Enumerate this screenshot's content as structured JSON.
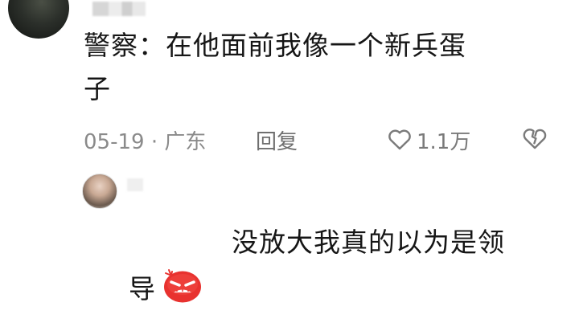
{
  "comments": [
    {
      "text_line1": "警察：在他面前我像一个新兵蛋",
      "text_line2": "子",
      "date_location": "05-19 · 广东",
      "reply_label": "回复",
      "like_count": "1.1万"
    },
    {
      "text_line1": "没放大我真的以为是领",
      "text_line2": "导"
    }
  ],
  "icons": {
    "like": "heart-outline-icon",
    "dislike": "broken-heart-icon",
    "emoji": "angry-face-icon"
  },
  "colors": {
    "text": "#161616",
    "meta": "#8a8a8a",
    "emoji_red": "#e8322f"
  }
}
